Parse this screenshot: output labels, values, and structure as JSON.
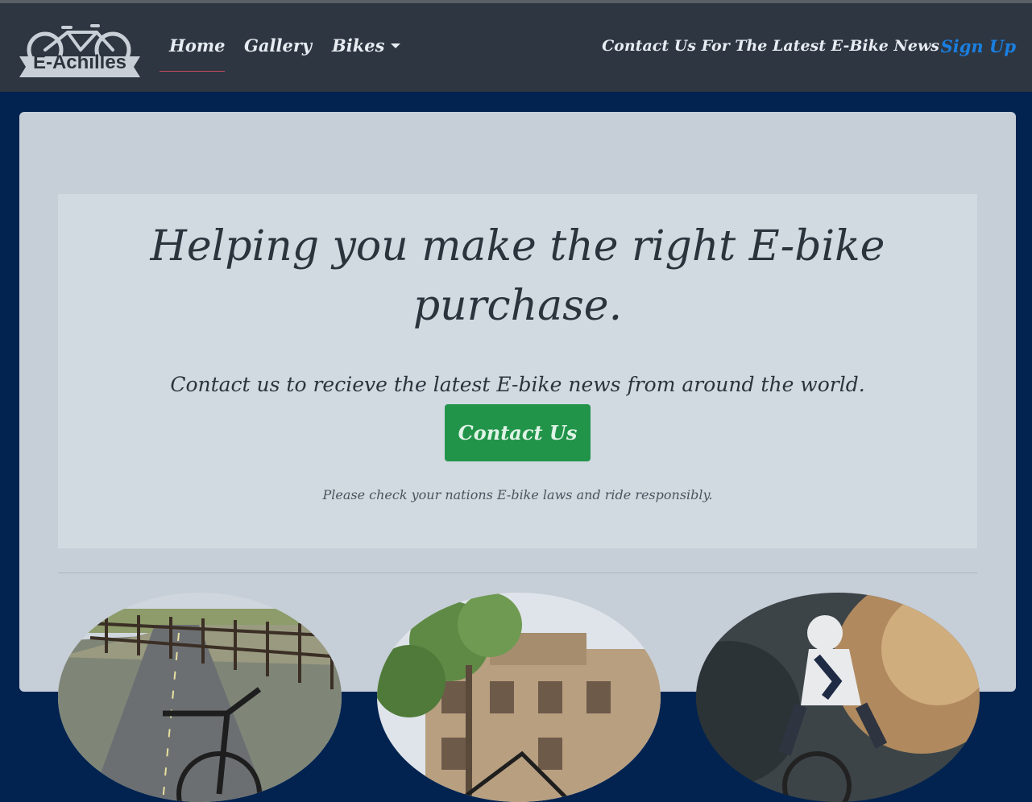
{
  "brand": {
    "logo_text": "E-Achilles",
    "logo_icon": "bicycle-icon"
  },
  "nav": {
    "home": "Home",
    "gallery": "Gallery",
    "bikes": "Bikes",
    "contact": "Contact Us For The Latest E-Bike News",
    "signup": "Sign Up"
  },
  "hero": {
    "title": "Helping you make the right E-bike purchase.",
    "subtitle": "Contact us to recieve the latest E-bike news from around the world.",
    "button_label": "Contact Us",
    "disclaimer": "Please check your nations E-bike laws and ride responsibly."
  },
  "colors": {
    "page_background": "#022350",
    "navbar": "#2d3641",
    "panel": "#c6ced7",
    "jumbotron": "#d1d9e1",
    "primary_button": "#22944a",
    "signup_link": "#1a7fe0",
    "active_underline": "#c84b5e"
  }
}
